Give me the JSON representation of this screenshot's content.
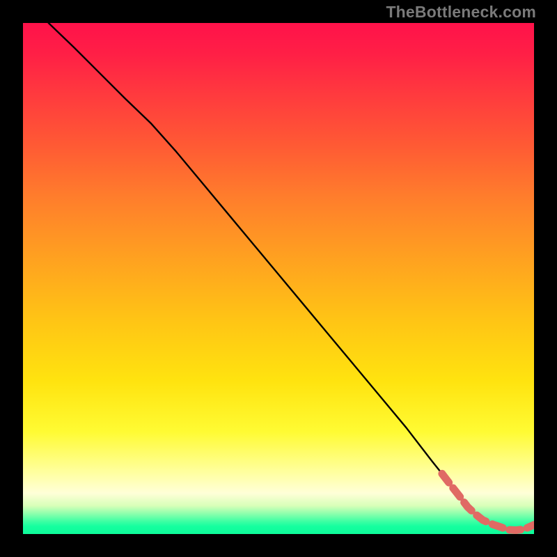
{
  "watermark": "TheBottleneck.com",
  "colors": {
    "line": "#000000",
    "marker_fill": "#e06a64",
    "marker_stroke": "#8a3a36",
    "plot_border": "#000000"
  },
  "chart_data": {
    "type": "line",
    "title": "",
    "xlabel": "",
    "ylabel": "",
    "xlim": [
      0,
      100
    ],
    "ylim": [
      0,
      100
    ],
    "grid": false,
    "series": [
      {
        "name": "curve",
        "x": [
          5,
          10,
          15,
          20,
          25,
          30,
          35,
          40,
          45,
          50,
          55,
          60,
          65,
          70,
          75,
          80,
          82,
          84,
          86,
          87,
          88,
          89,
          90,
          91,
          92,
          93,
          94,
          95,
          96,
          97,
          98,
          99,
          100
        ],
        "y": [
          100,
          95.2,
          90.2,
          85.2,
          80.4,
          74.8,
          68.8,
          62.8,
          56.8,
          50.8,
          44.8,
          38.8,
          32.8,
          26.8,
          20.8,
          14.3,
          11.8,
          9.2,
          6.6,
          5.3,
          4.3,
          3.45,
          2.72,
          2.12,
          1.64,
          1.27,
          1.0,
          0.82,
          0.74,
          0.76,
          0.92,
          1.24,
          1.8
        ]
      }
    ],
    "markers": {
      "name": "dashed-segment-points",
      "x": [
        82.0,
        83.0,
        84.0,
        85.5,
        87.0,
        88.5,
        90.0,
        92.0,
        93.5,
        95.0,
        96.5,
        98.0,
        100.0
      ],
      "y": [
        11.8,
        10.5,
        9.2,
        7.3,
        5.3,
        3.9,
        2.72,
        1.85,
        1.35,
        0.82,
        0.75,
        0.92,
        1.8
      ]
    }
  }
}
